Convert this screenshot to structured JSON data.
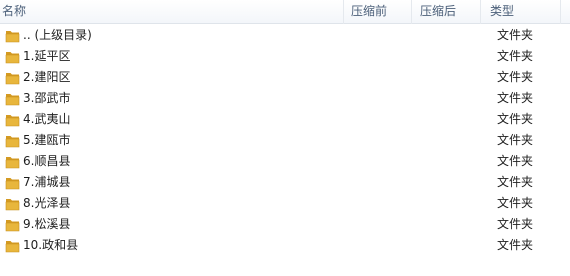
{
  "columns": {
    "name": "名称",
    "compressed_before": "压缩前",
    "compressed_after": "压缩后",
    "type": "类型"
  },
  "icons": {
    "folder": "folder-icon",
    "folder_color": "#e8b63c"
  },
  "rows": [
    {
      "name": ".. (上级目录)",
      "type": "文件夹"
    },
    {
      "name": "1.延平区",
      "type": "文件夹"
    },
    {
      "name": "2.建阳区",
      "type": "文件夹"
    },
    {
      "name": "3.邵武市",
      "type": "文件夹"
    },
    {
      "name": "4.武夷山",
      "type": "文件夹"
    },
    {
      "name": "5.建瓯市",
      "type": "文件夹"
    },
    {
      "name": "6.顺昌县",
      "type": "文件夹"
    },
    {
      "name": "7.浦城县",
      "type": "文件夹"
    },
    {
      "name": "8.光泽县",
      "type": "文件夹"
    },
    {
      "name": "9.松溪县",
      "type": "文件夹"
    },
    {
      "name": "10.政和县",
      "type": "文件夹"
    }
  ]
}
